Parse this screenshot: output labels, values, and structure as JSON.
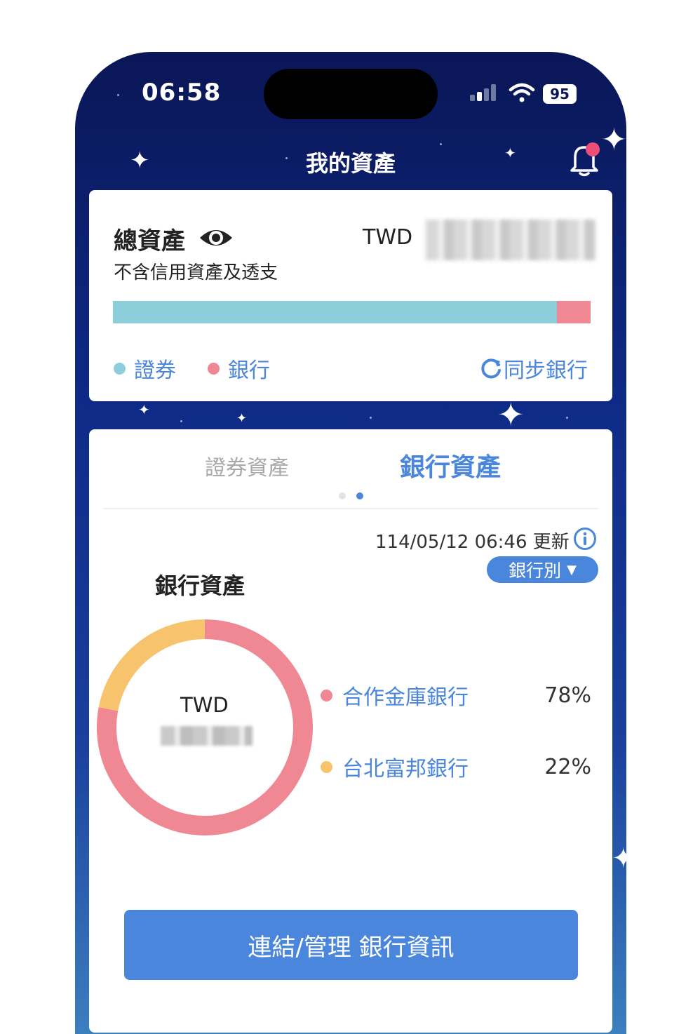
{
  "status_bar": {
    "time": "06:58",
    "battery": "95"
  },
  "header": {
    "title": "我的資產"
  },
  "summary": {
    "label": "總資產",
    "sublabel": "不含信用資產及透支",
    "currency": "TWD",
    "securities_share": 0.93,
    "bank_share": 0.07,
    "legend": [
      {
        "label": "證券",
        "color": "#8ccfda"
      },
      {
        "label": "銀行",
        "color": "#ef8893"
      }
    ],
    "sync_label": "同步銀行"
  },
  "tabs": [
    {
      "label": "證券資產",
      "active": false
    },
    {
      "label": "銀行資產",
      "active": true
    }
  ],
  "bank_panel": {
    "updated": "114/05/12 06:46 更新",
    "dropdown_label": "銀行別",
    "section_title": "銀行資產",
    "donut_currency": "TWD",
    "banks": [
      {
        "name": "合作金庫銀行",
        "percent_label": "78%",
        "value": 78,
        "color": "#ef8893"
      },
      {
        "name": "台北富邦銀行",
        "percent_label": "22%",
        "value": 22,
        "color": "#f7c36d"
      }
    ],
    "cta_label": "連結/管理 銀行資訊"
  }
}
